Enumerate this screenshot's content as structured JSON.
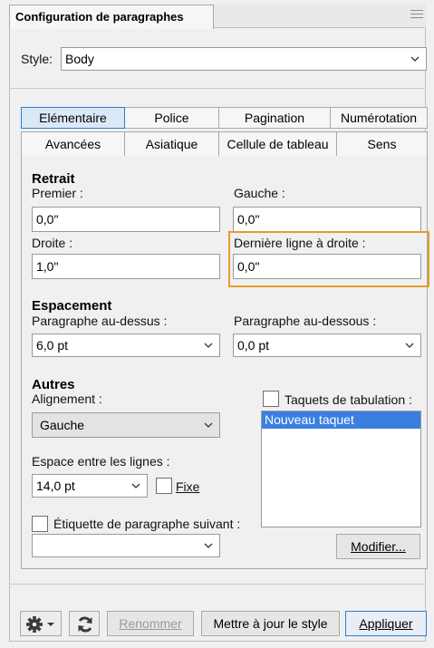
{
  "panel": {
    "title": "Configuration de paragraphes"
  },
  "style": {
    "label": "Style:",
    "value": "Body"
  },
  "tabs_row1": [
    "Elémentaire",
    "Police",
    "Pagination",
    "Numérotation"
  ],
  "tabs_row2": [
    "Avancées",
    "Asiatique",
    "Cellule de tableau",
    "Sens"
  ],
  "retrait": {
    "heading": "Retrait",
    "premier_label": "Premier :",
    "premier_value": "0,0\"",
    "gauche_label": "Gauche :",
    "gauche_value": "0,0\"",
    "droite_label": "Droite :",
    "droite_value": "1,0\"",
    "derniere_label": "Dernière ligne à droite :",
    "derniere_value": "0,0\""
  },
  "espacement": {
    "heading": "Espacement",
    "dessus_label": "Paragraphe au-dessus :",
    "dessus_value": "6,0 pt",
    "dessous_label": "Paragraphe au-dessous :",
    "dessous_value": "0,0 pt"
  },
  "autres": {
    "heading": "Autres",
    "alignement_label": "Alignement :",
    "alignement_value": "Gauche",
    "interligne_label": "Espace entre les lignes :",
    "interligne_value": "14,0 pt",
    "fixe_label": "Fixe",
    "taquets_label": "Taquets de tabulation :",
    "taquets_items": [
      "Nouveau taquet"
    ],
    "etiquette_label": "Étiquette de paragraphe suivant :",
    "etiquette_value": "",
    "modifier_label": "Modifier..."
  },
  "footer": {
    "renommer": "Renommer",
    "mettre_a_jour": "Mettre à jour le style",
    "appliquer": "Appliquer"
  },
  "colors": {
    "accent": "#3a7fe0",
    "highlight": "#e79b2b"
  }
}
